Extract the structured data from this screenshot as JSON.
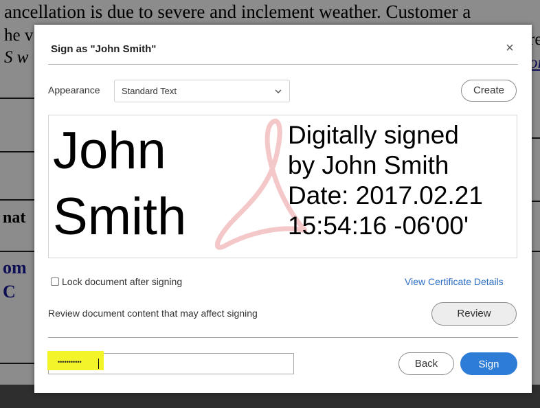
{
  "background_doc": {
    "line1": "ancellation is due to severe and inclement weather.  Customer a",
    "line2": "he v",
    "line3": "S w",
    "line4": "nat",
    "line5": "om",
    "line6": "C",
    "right1": "re",
    "right2": "or"
  },
  "dialog": {
    "title": "Sign as \"John Smith\"",
    "close_glyph": "×",
    "appearance": {
      "label": "Appearance",
      "selected": "Standard Text",
      "chevron_icon": "chevron-down-icon"
    },
    "create_label": "Create",
    "preview": {
      "name_line1": "John",
      "name_line2": "Smith",
      "info_line1": "Digitally signed",
      "info_line2": "by John Smith",
      "info_line3": "Date: 2017.02.21",
      "info_line4": "15:54:16 -06'00'",
      "watermark_icon": "acrobat-logo-icon",
      "watermark_color": "#f4c8c8"
    },
    "lock_label": "Lock document after signing",
    "lock_checked": false,
    "view_cert_label": "View Certificate Details",
    "review_text": "Review document content that may affect signing",
    "review_label": "Review",
    "password": {
      "masked_value": "•••••••••••"
    },
    "back_label": "Back",
    "sign_label": "Sign",
    "accent_color": "#2d7cd6",
    "link_color": "#2a6cc2",
    "highlight_color": "#f4f42a"
  }
}
